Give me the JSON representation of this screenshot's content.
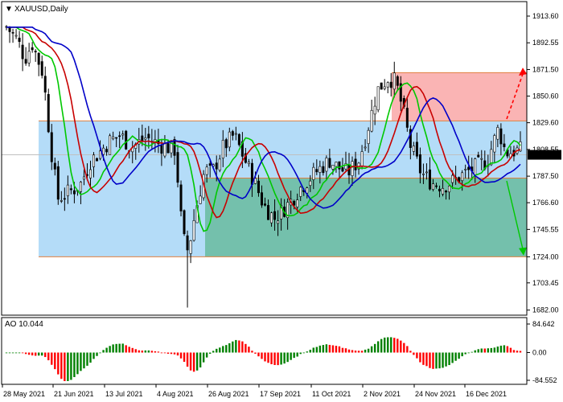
{
  "header": {
    "symbol_label": "XAUUSD,Daily",
    "dropdown_glyph": "▼"
  },
  "price_axis": {
    "ticks": [
      "1913.60",
      "1892.55",
      "1871.50",
      "1850.60",
      "1829.60",
      "1808.55",
      "1787.50",
      "1766.60",
      "1745.55",
      "1724.00",
      "1703.45",
      "1682.00"
    ],
    "current_price": "1804.32"
  },
  "indicator": {
    "label": "AO 10.044",
    "ticks": [
      "84.642",
      "0.00",
      "-84.552"
    ]
  },
  "time_axis": {
    "labels": [
      "28 May 2021",
      "21 Jun 2021",
      "13 Jul 2021",
      "4 Aug 2021",
      "26 Aug 2021",
      "17 Sep 2021",
      "11 Oct 2021",
      "2 Nov 2021",
      "24 Nov 2021",
      "16 Dec 2021"
    ]
  },
  "colors": {
    "candle": "#000000",
    "ma_fast": "#00c800",
    "ma_mid": "#c80000",
    "ma_slow": "#0000c8",
    "zone_blue": "#b4dcf8",
    "zone_green": "#74c0ac",
    "zone_red": "#fab4b4",
    "level_line": "#e08040",
    "ao_up": "#008000",
    "ao_down": "#ff0000",
    "arrow_up": "#ff0000",
    "arrow_down": "#00c800"
  },
  "chart_data": {
    "type": "candlestick",
    "symbol": "XAUUSD",
    "timeframe": "Daily",
    "y_range": [
      1678,
      1925
    ],
    "current_price": 1804.32,
    "levels": {
      "upper": 1831,
      "middle": 1786,
      "lower": 1724,
      "top_target": 1869
    },
    "forecast": {
      "up_target": 1873,
      "down_target": 1725
    }
  }
}
